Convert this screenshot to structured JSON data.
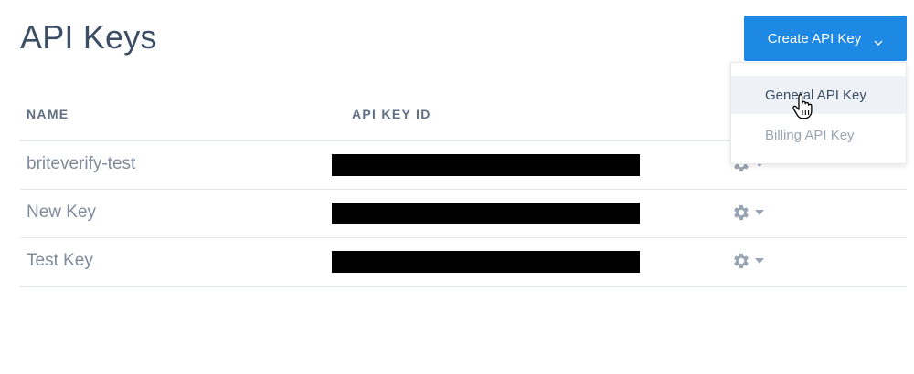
{
  "header": {
    "title": "API Keys",
    "create_button_label": "Create API Key"
  },
  "table": {
    "columns": [
      "NAME",
      "API KEY ID"
    ],
    "rows": [
      {
        "name": "briteverify-test",
        "api_key_id": ""
      },
      {
        "name": "New Key",
        "api_key_id": ""
      },
      {
        "name": "Test Key",
        "api_key_id": ""
      }
    ]
  },
  "dropdown": {
    "items": [
      {
        "label": "General API Key",
        "state": "hovered"
      },
      {
        "label": "Billing API Key",
        "state": "normal"
      }
    ]
  },
  "colors": {
    "accent": "#1e88e5",
    "title": "#3c4d66",
    "muted_text": "#7f8b9b",
    "redaction": "#000000",
    "divider": "#e3e7ec"
  },
  "icons": {
    "row_actions": "gear-icon",
    "row_actions_caret": "caret-down-icon",
    "button_chevron": "chevron-down-icon",
    "pointer": "hand-pointer-icon"
  }
}
